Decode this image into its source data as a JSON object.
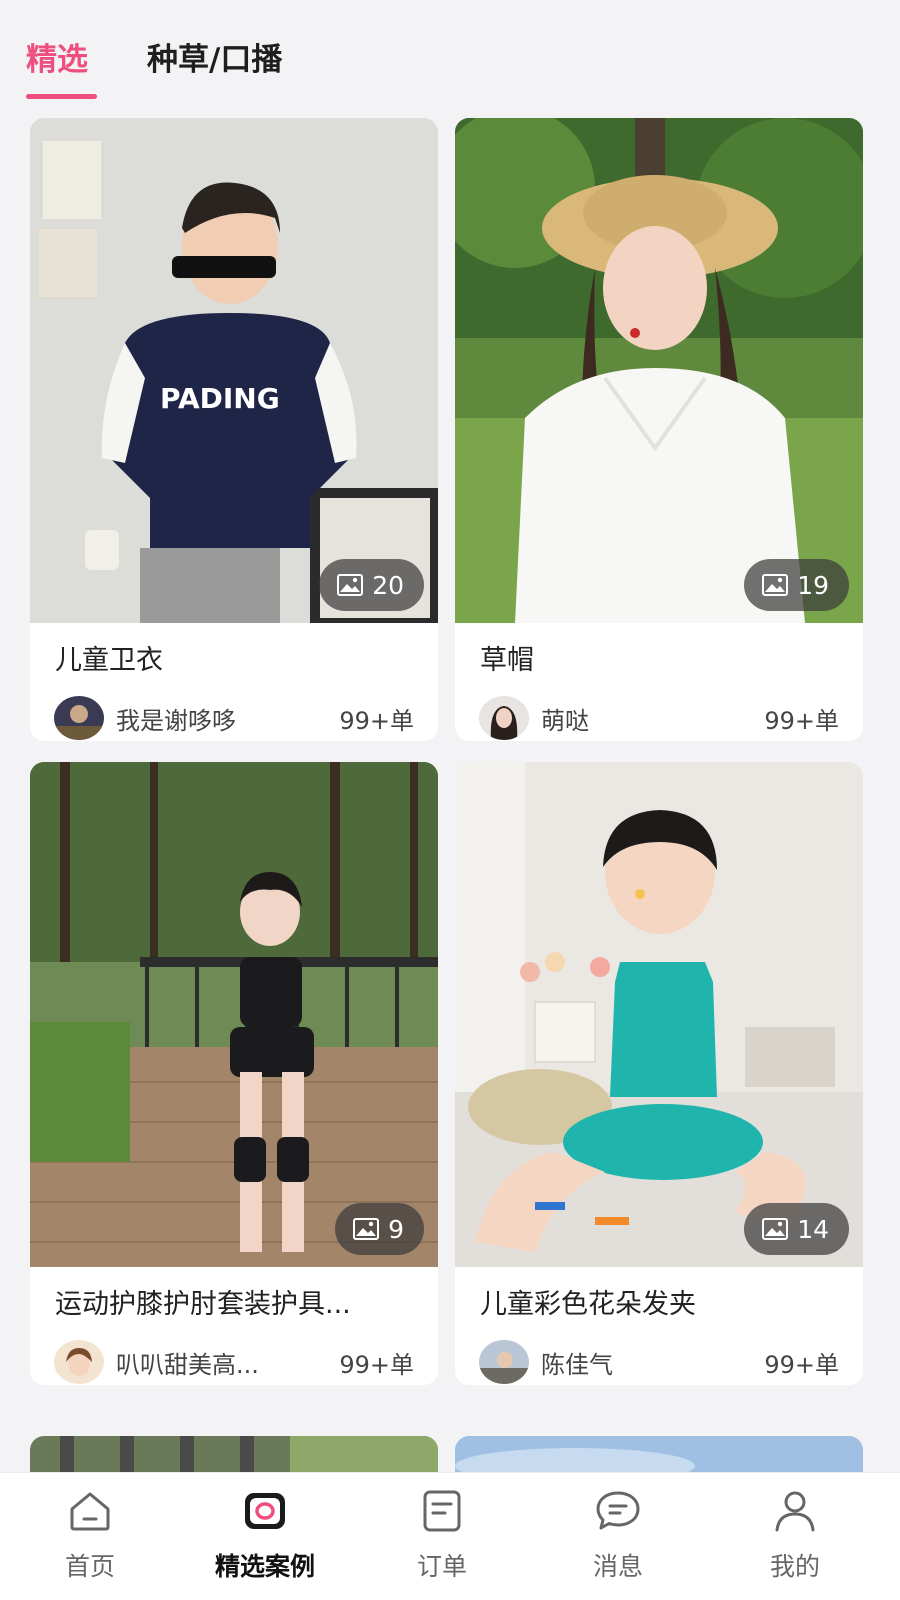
{
  "tabs": [
    {
      "label": "精选",
      "active": true
    },
    {
      "label": "种草/口播",
      "active": false
    }
  ],
  "cards": [
    {
      "title": "儿童卫衣",
      "author": "我是谢哆哆",
      "orders": "99+单",
      "image_count": "20"
    },
    {
      "title": "草帽",
      "author": "萌哒",
      "orders": "99+单",
      "image_count": "19"
    },
    {
      "title": "运动护膝护肘套装护具...",
      "author": "叭叭甜美高...",
      "orders": "99+单",
      "image_count": "9"
    },
    {
      "title": "儿童彩色花朵发夹",
      "author": "陈佳气",
      "orders": "99+单",
      "image_count": "14"
    }
  ],
  "bottom_nav": [
    {
      "label": "首页",
      "icon": "home-icon",
      "active": false
    },
    {
      "label": "精选案例",
      "icon": "camera-icon",
      "active": true
    },
    {
      "label": "订单",
      "icon": "document-icon",
      "active": false
    },
    {
      "label": "消息",
      "icon": "chat-bubble-icon",
      "active": false
    },
    {
      "label": "我的",
      "icon": "user-icon",
      "active": false
    }
  ],
  "colors": {
    "accent": "#ee4f7e",
    "background": "#f3f3f6"
  }
}
